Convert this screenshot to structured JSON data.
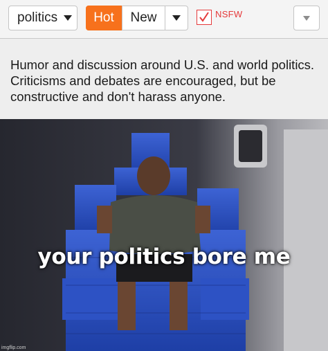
{
  "toolbar": {
    "community": "politics",
    "sort_hot": "Hot",
    "sort_new": "New",
    "nsfw_label": "NSFW",
    "nsfw_checked": true,
    "accent_color": "#f7711c",
    "nsfw_color": "#e5393a"
  },
  "description": {
    "lines": [
      "Humor and discussion around U.S. and world politics.",
      "Criticisms and debates are encouraged, but be",
      "constructive and don't harass anyone."
    ]
  },
  "meme": {
    "caption": "your politics bore me",
    "watermark": "imgflip.com"
  }
}
